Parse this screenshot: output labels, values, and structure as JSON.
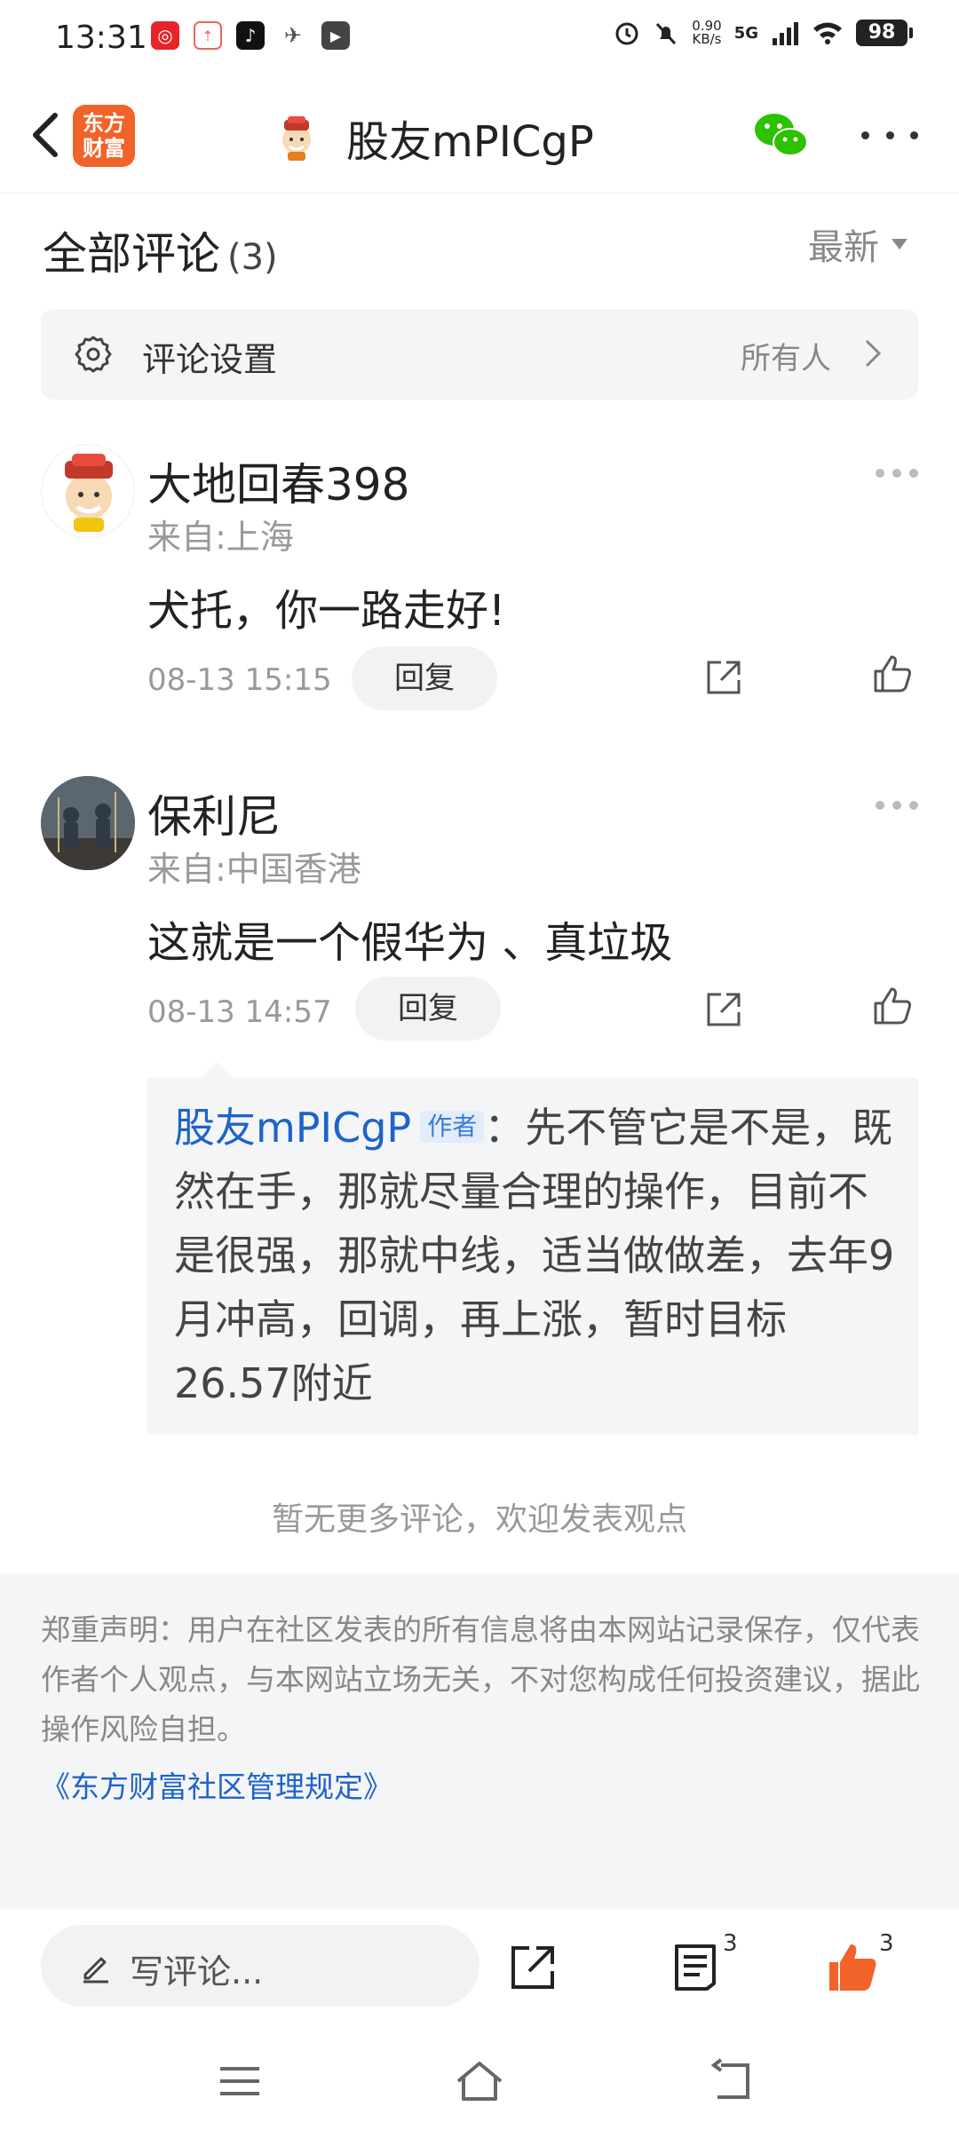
{
  "status_bar": {
    "time": "13:31",
    "net_speed_value": "0.90",
    "net_speed_unit": "KB/s",
    "network": "5G",
    "battery": "98"
  },
  "header": {
    "logo_text_line1": "东方",
    "logo_text_line2": "财富",
    "title": "股友mPICgP"
  },
  "comments_section": {
    "title": "全部评论",
    "count": "(3)",
    "sort_label": "最新",
    "settings_label": "评论设置",
    "settings_value": "所有人"
  },
  "comments": [
    {
      "username": "大地回春398",
      "location": "来自:上海",
      "text": "犬托，你一路走好!",
      "time": "08-13 15:15",
      "reply_label": "回复"
    },
    {
      "username": "保利尼",
      "location": "来自:中国香港",
      "text": "这就是一个假华为 、真垃圾",
      "time": "08-13 14:57",
      "reply_label": "回复",
      "author_reply": {
        "name": "股友mPICgP",
        "tag": "作者",
        "text": "：先不管它是不是，既然在手，那就尽量合理的操作，目前不是很强，那就中线，适当做做差，去年9月冲高，回调，再上涨，暂时目标26.57附近"
      }
    }
  ],
  "no_more_text": "暂无更多评论，欢迎发表观点",
  "notice": {
    "text": "郑重声明：用户在社区发表的所有信息将由本网站记录保存，仅代表作者个人观点，与本网站立场无关，不对您构成任何投资建议，据此操作风险自担。",
    "link": "《东方财富社区管理规定》"
  },
  "bottom_bar": {
    "write_placeholder": "写评论...",
    "comments_count": "3",
    "likes_count": "3"
  },
  "colors": {
    "accent_orange": "#f2632a",
    "link_blue": "#1e63c8",
    "wechat_green": "#2dc100"
  }
}
